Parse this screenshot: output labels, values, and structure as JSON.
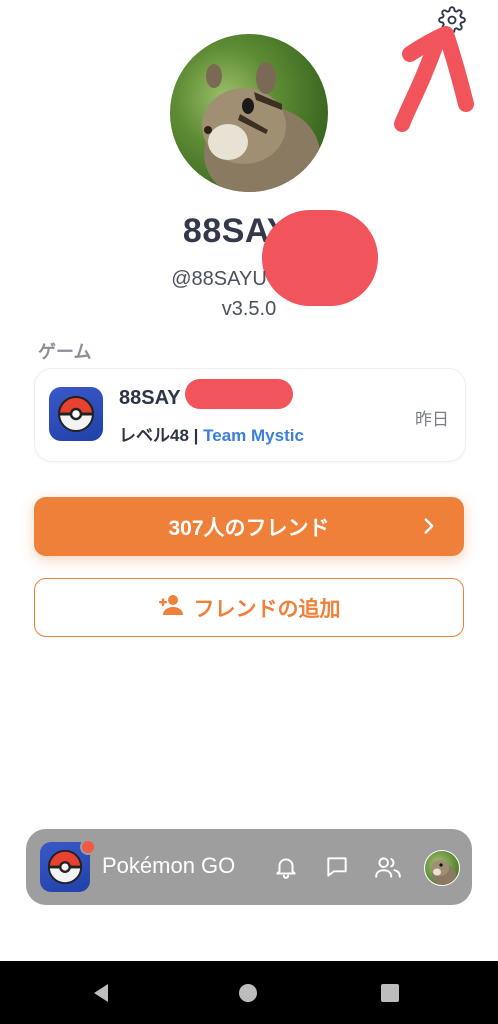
{
  "profile": {
    "display_name": "88SAYU",
    "handle": "@88SAYU",
    "version": "v3.5.0"
  },
  "games_section": {
    "label": "ゲーム",
    "game": {
      "title": "88SAY",
      "level": "レベル48",
      "separator": " | ",
      "team": "Team Mystic",
      "last_active": "昨日"
    }
  },
  "actions": {
    "friends_label": "307人のフレンド",
    "add_friend_label": "フレンドの追加"
  },
  "bottom_bar": {
    "game_name": "Pokémon GO",
    "icons": [
      "bell-icon",
      "chat-icon",
      "friends-icon"
    ]
  },
  "colors": {
    "accent": "#ef803a",
    "team_mystic": "#3c7fd8",
    "annotation_red": "#f2545b",
    "bottom_bar": "#9e9e9e"
  }
}
